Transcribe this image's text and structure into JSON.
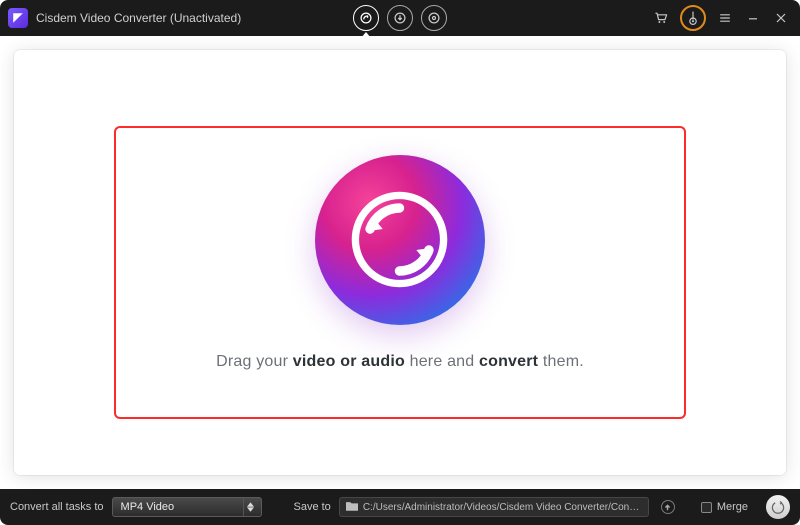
{
  "titlebar": {
    "title": "Cisdem Video Converter (Unactivated)"
  },
  "modes": {
    "convert_tooltip": "Convert",
    "download_tooltip": "Download",
    "rip_tooltip": "Rip"
  },
  "dropzone": {
    "prefix": "Drag your ",
    "bold1": "video or audio",
    "mid": " here and ",
    "bold2": "convert",
    "suffix": " them."
  },
  "bottombar": {
    "convert_label": "Convert all tasks to",
    "format_value": "MP4 Video",
    "save_label": "Save to",
    "save_path": "C:/Users/Administrator/Videos/Cisdem Video Converter/Converted",
    "merge_label": "Merge"
  }
}
